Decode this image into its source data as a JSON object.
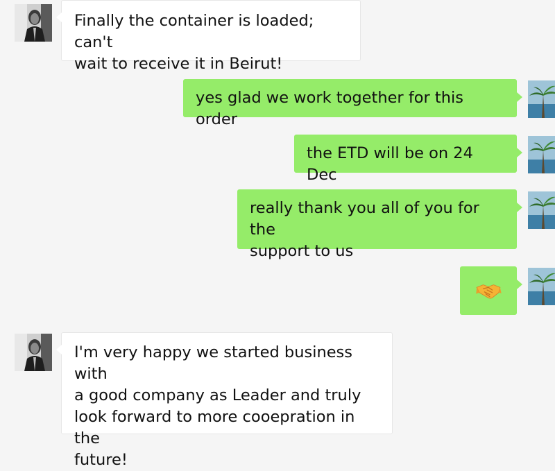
{
  "chat": {
    "messages": [
      {
        "side": "incoming",
        "text": "Finally the container is loaded; can't\nwait to receive it in Beirut!"
      },
      {
        "side": "outgoing",
        "text": "yes glad we work together for this order"
      },
      {
        "side": "outgoing",
        "text": "the ETD will be on 24 Dec"
      },
      {
        "side": "outgoing",
        "text": "really thank you all of you for the\nsupport to us"
      },
      {
        "side": "outgoing",
        "emoji": "handshake-emoji"
      },
      {
        "side": "incoming",
        "text": "I'm very happy we started business with\na good company as Leader and truly\nlook forward to more cooepration in the\nfuture!"
      }
    ]
  },
  "colors": {
    "background": "#f5f5f5",
    "incoming_bubble": "#ffffff",
    "outgoing_bubble": "#95ec69",
    "text": "#111111"
  },
  "icons": {
    "incoming_avatar": "person-avatar-icon",
    "outgoing_avatar": "palm-tree-avatar-icon",
    "reaction": "handshake-emoji"
  }
}
